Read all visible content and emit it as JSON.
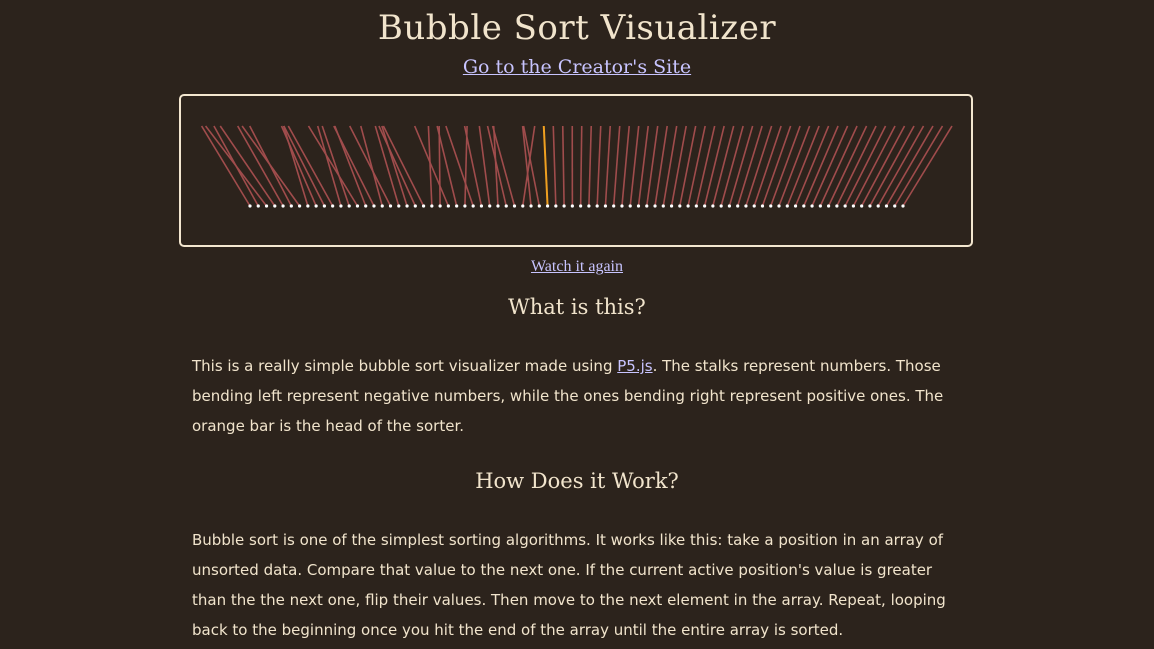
{
  "header": {
    "title": "Bubble Sort Visualizer",
    "creator_link": "Go to the Creator's Site"
  },
  "visualizer": {
    "stalk_color": "#a04c4c",
    "head_color": "#f0a020",
    "dot_color": "#ffffff",
    "border_color": "#f3e6cf"
  },
  "controls": {
    "watch_again": "Watch it again"
  },
  "sections": [
    {
      "heading": "What is this?",
      "text_before_link": "This is a really simple bubble sort visualizer made using ",
      "link_text": "P5.js",
      "text_after_link": ". The stalks represent numbers. Those bending left represent negative numbers, while the ones bending right represent positive ones. The orange bar is the head of the sorter."
    },
    {
      "heading": "How Does it Work?",
      "text": "Bubble sort is one of the simplest sorting algorithms. It works like this: take a position in an array of unsorted data. Compare that value to the next one. If the current active position's value is greater than the the next one, flip their values. Then move to the next element in the array. Repeat, looping back to the beginning once you hit the end of the array until the entire array is sorted."
    }
  ],
  "colors": {
    "background": "#2c231c",
    "text": "#f1e4cc",
    "link": "#c8c4ff"
  }
}
